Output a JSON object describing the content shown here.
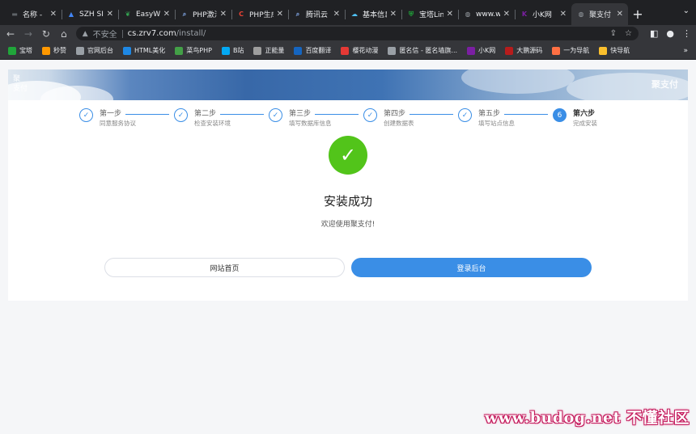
{
  "browser": {
    "tabs": [
      {
        "title": "名称 - ",
        "icon": "server-icon",
        "color": "#5f6368"
      },
      {
        "title": "SZH SI",
        "icon": "triangle-logo-icon",
        "color": "#4285f4"
      },
      {
        "title": "EasyWe",
        "icon": "leaf-icon",
        "color": "#34a853"
      },
      {
        "title": "PHP激活",
        "icon": "search-icon",
        "color": "#8ab4f8"
      },
      {
        "title": "PHP生成",
        "icon": "c-logo-icon",
        "color": "#ea4335"
      },
      {
        "title": "腾讯云",
        "icon": "search-icon",
        "color": "#8ab4f8"
      },
      {
        "title": "基本信息",
        "icon": "cloud-icon",
        "color": "#4fc3f7"
      },
      {
        "title": "宝塔Lin",
        "icon": "shield-icon",
        "color": "#20a53a"
      },
      {
        "title": "www.w",
        "icon": "globe-icon",
        "color": "#9aa0a6"
      },
      {
        "title": "小K网",
        "icon": "k-logo-icon",
        "color": "#7b1fa2"
      },
      {
        "title": "聚支付",
        "icon": "globe-icon",
        "color": "#9aa0a6",
        "active": true
      }
    ],
    "new_tab": "+",
    "address": {
      "security_label": "不安全",
      "host": "cs.zrv7.com",
      "path": "/install/"
    },
    "bookmarks": [
      {
        "label": "宝塔",
        "color": "#20a53a"
      },
      {
        "label": "秒赞",
        "color": "#ff9800"
      },
      {
        "label": "官网后台",
        "color": "#9aa0a6"
      },
      {
        "label": "HTML美化",
        "color": "#1e88e5"
      },
      {
        "label": "菜鸟PHP",
        "color": "#43a047"
      },
      {
        "label": "B站",
        "color": "#03a9f4"
      },
      {
        "label": "正能量",
        "color": "#9e9e9e"
      },
      {
        "label": "百度翻译",
        "color": "#1565c0"
      },
      {
        "label": "樱花动漫",
        "color": "#e53935"
      },
      {
        "label": "匿名信 - 匿名墙旗...",
        "color": "#9aa0a6"
      },
      {
        "label": "小K网",
        "color": "#7b1fa2"
      },
      {
        "label": "大鹏源码",
        "color": "#b71c1c"
      },
      {
        "label": "一为导航",
        "color": "#ff7043"
      },
      {
        "label": "快导航",
        "color": "#fbc02d"
      }
    ],
    "bookmarks_more": "»"
  },
  "banner": {
    "left_text_1": "聚",
    "left_text_2": "支付",
    "right_text": "聚支付"
  },
  "steps": [
    {
      "number": "✓",
      "title": "第一步",
      "desc": "同意服务协议",
      "done": true
    },
    {
      "number": "✓",
      "title": "第二步",
      "desc": "检查安装环境",
      "done": true
    },
    {
      "number": "✓",
      "title": "第三步",
      "desc": "填写数据库信息",
      "done": true
    },
    {
      "number": "✓",
      "title": "第四步",
      "desc": "创建数据表",
      "done": true
    },
    {
      "number": "✓",
      "title": "第五步",
      "desc": "填写站点信息",
      "done": true
    },
    {
      "number": "6",
      "title": "第六步",
      "desc": "完成安装",
      "done": false
    }
  ],
  "result": {
    "title": "安装成功",
    "message": "欢迎使用聚支付!",
    "success_color": "#52c41a"
  },
  "actions": {
    "home_label": "网站首页",
    "login_label": "登录后台",
    "accent": "#3a8ee6"
  },
  "watermark": "www.budog.net 不懂社区"
}
